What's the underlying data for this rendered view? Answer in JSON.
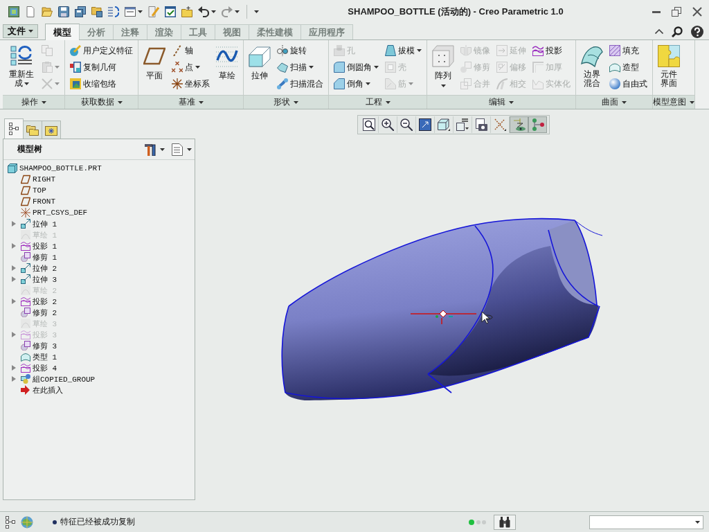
{
  "window": {
    "title": "SHAMPOO_BOTTLE (活动的) - Creo Parametric 1.0"
  },
  "quick_access": [
    {
      "disabled": false,
      "dropdown": false
    },
    {
      "disabled": false,
      "dropdown": false
    },
    {
      "disabled": false,
      "dropdown": false
    },
    {
      "disabled": false,
      "dropdown": false
    },
    {
      "disabled": false,
      "dropdown": false
    },
    {
      "disabled": false,
      "dropdown": false
    },
    {
      "disabled": false,
      "dropdown": false
    },
    {
      "disabled": false,
      "dropdown": true
    },
    {
      "disabled": false,
      "dropdown": false
    },
    {
      "disabled": false,
      "dropdown": false
    },
    {
      "disabled": false,
      "dropdown": false
    },
    {
      "disabled": false,
      "dropdown": true
    },
    {
      "disabled": true,
      "dropdown": true
    }
  ],
  "ribbon": {
    "file_menu": {
      "label": "文件"
    },
    "tabs": [
      {
        "label": "模型",
        "selected": true
      },
      {
        "label": "分析",
        "selected": false
      },
      {
        "label": "注释",
        "selected": false
      },
      {
        "label": "渲染",
        "selected": false
      },
      {
        "label": "工具",
        "selected": false
      },
      {
        "label": "视图",
        "selected": false
      },
      {
        "label": "柔性建模",
        "selected": false
      },
      {
        "label": "应用程序",
        "selected": false
      }
    ],
    "groups": [
      {
        "label": "操作",
        "columns": [
          [
            {
              "kind": "large",
              "label": "重新生成",
              "dropdown": true,
              "disabled": false
            }
          ],
          [
            {
              "kind": "icon",
              "dropdown": false,
              "disabled": true
            },
            {
              "kind": "icon",
              "dropdown": true,
              "disabled": true
            },
            {
              "kind": "icon",
              "dropdown": true,
              "disabled": true
            }
          ]
        ]
      },
      {
        "label": "获取数据",
        "columns": [
          [
            {
              "kind": "small",
              "label": "用户定义特征",
              "dropdown": false,
              "disabled": false
            },
            {
              "kind": "small",
              "label": "复制几何",
              "dropdown": false,
              "disabled": false
            },
            {
              "kind": "small",
              "label": "收缩包络",
              "dropdown": false,
              "disabled": false
            }
          ]
        ]
      },
      {
        "label": "基准",
        "columns": [
          [
            {
              "kind": "large",
              "label": "平面",
              "dropdown": false,
              "disabled": false
            }
          ],
          [
            {
              "kind": "small",
              "label": "轴",
              "dropdown": false,
              "disabled": false
            },
            {
              "kind": "small",
              "label": "点",
              "dropdown": true,
              "disabled": false
            },
            {
              "kind": "small",
              "label": "坐标系",
              "dropdown": false,
              "disabled": false
            }
          ],
          [
            {
              "kind": "large",
              "label": "草绘",
              "dropdown": false,
              "disabled": false
            }
          ]
        ]
      },
      {
        "label": "形状",
        "columns": [
          [
            {
              "kind": "large",
              "label": "拉伸",
              "dropdown": false,
              "disabled": false
            }
          ],
          [
            {
              "kind": "small",
              "label": "旋转",
              "dropdown": false,
              "disabled": false
            },
            {
              "kind": "small",
              "label": "扫描",
              "dropdown": true,
              "disabled": false
            },
            {
              "kind": "small",
              "label": "扫描混合",
              "dropdown": false,
              "disabled": false
            }
          ]
        ]
      },
      {
        "label": "工程",
        "columns": [
          [
            {
              "kind": "small",
              "label": "孔",
              "dropdown": false,
              "disabled": true
            },
            {
              "kind": "small",
              "label": "倒圆角",
              "dropdown": true,
              "disabled": false
            },
            {
              "kind": "small",
              "label": "倒角",
              "dropdown": true,
              "disabled": false
            }
          ],
          [
            {
              "kind": "small",
              "label": "拔模",
              "dropdown": true,
              "disabled": false
            },
            {
              "kind": "small",
              "label": "壳",
              "dropdown": false,
              "disabled": true
            },
            {
              "kind": "small",
              "label": "筋",
              "dropdown": true,
              "disabled": true
            }
          ]
        ]
      },
      {
        "label": "编辑",
        "columns": [
          [
            {
              "kind": "large",
              "label": "阵列",
              "dropdown": true,
              "disabled": false
            }
          ],
          [
            {
              "kind": "small",
              "label": "镜像",
              "dropdown": false,
              "disabled": true
            },
            {
              "kind": "small",
              "label": "修剪",
              "dropdown": false,
              "disabled": true
            },
            {
              "kind": "small",
              "label": "合并",
              "dropdown": false,
              "disabled": true
            }
          ],
          [
            {
              "kind": "small",
              "label": "延伸",
              "dropdown": false,
              "disabled": true
            },
            {
              "kind": "small",
              "label": "偏移",
              "dropdown": false,
              "disabled": true
            },
            {
              "kind": "small",
              "label": "相交",
              "dropdown": false,
              "disabled": true
            }
          ],
          [
            {
              "kind": "small",
              "label": "投影",
              "dropdown": false,
              "disabled": false
            },
            {
              "kind": "small",
              "label": "加厚",
              "dropdown": false,
              "disabled": true
            },
            {
              "kind": "small",
              "label": "实体化",
              "dropdown": false,
              "disabled": true
            }
          ]
        ]
      },
      {
        "label": "曲面",
        "columns": [
          [
            {
              "kind": "large",
              "label": "边界混合",
              "dropdown": false,
              "disabled": false
            }
          ],
          [
            {
              "kind": "small",
              "label": "填充",
              "dropdown": false,
              "disabled": false
            },
            {
              "kind": "small",
              "label": "造型",
              "dropdown": false,
              "disabled": false
            },
            {
              "kind": "small",
              "label": "自由式",
              "dropdown": false,
              "disabled": false
            }
          ]
        ]
      },
      {
        "label": "模型意图",
        "columns": [
          [
            {
              "kind": "large",
              "label": "元件界面",
              "dropdown": false,
              "disabled": false
            }
          ]
        ]
      }
    ]
  },
  "view_toolbar": [
    {
      "on": false
    },
    {
      "on": false
    },
    {
      "on": false
    },
    {
      "on": false
    },
    {
      "on": false
    },
    {
      "on": false
    },
    {
      "on": false
    },
    {
      "on": false
    },
    {
      "on": true
    },
    {
      "on": true
    }
  ],
  "navigator": {
    "tabs": [
      {
        "selected": true
      },
      {
        "selected": false
      },
      {
        "selected": false
      }
    ],
    "title": "模型树",
    "tree": [
      {
        "kind": "part",
        "label": "SHAMPOO_BOTTLE.PRT",
        "disabled": false,
        "children": [
          {
            "kind": "plane",
            "label": "RIGHT",
            "disabled": false
          },
          {
            "kind": "plane",
            "label": "TOP",
            "disabled": false
          },
          {
            "kind": "plane",
            "label": "FRONT",
            "disabled": false
          },
          {
            "kind": "csys",
            "label": "PRT_CSYS_DEF",
            "disabled": false
          },
          {
            "kind": "extrude",
            "label": "拉伸 1",
            "disabled": false,
            "expanded": false
          },
          {
            "kind": "sketch",
            "label": "草绘 1",
            "disabled": true
          },
          {
            "kind": "projection",
            "label": "投影 1",
            "disabled": false,
            "expanded": false
          },
          {
            "kind": "trim",
            "label": "修剪 1",
            "disabled": false
          },
          {
            "kind": "extrude",
            "label": "拉伸 2",
            "disabled": false,
            "expanded": false
          },
          {
            "kind": "extrude",
            "label": "拉伸 3",
            "disabled": false,
            "expanded": false
          },
          {
            "kind": "sketch",
            "label": "草绘 2",
            "disabled": true
          },
          {
            "kind": "projection",
            "label": "投影 2",
            "disabled": false,
            "expanded": false
          },
          {
            "kind": "trim",
            "label": "修剪 2",
            "disabled": false
          },
          {
            "kind": "sketch",
            "label": "草绘 3",
            "disabled": true
          },
          {
            "kind": "projection",
            "label": "投影 3",
            "disabled": true,
            "expanded": false
          },
          {
            "kind": "trim",
            "label": "修剪 3",
            "disabled": false
          },
          {
            "kind": "style",
            "label": "类型 1",
            "disabled": false
          },
          {
            "kind": "projection",
            "label": "投影 4",
            "disabled": false,
            "expanded": false
          },
          {
            "kind": "group",
            "label": "組COPIED_GROUP",
            "disabled": false,
            "expanded": false
          },
          {
            "kind": "insert",
            "label": "在此插入",
            "disabled": false
          }
        ]
      }
    ]
  },
  "status_bar": {
    "message": "特征已经被成功复制"
  }
}
